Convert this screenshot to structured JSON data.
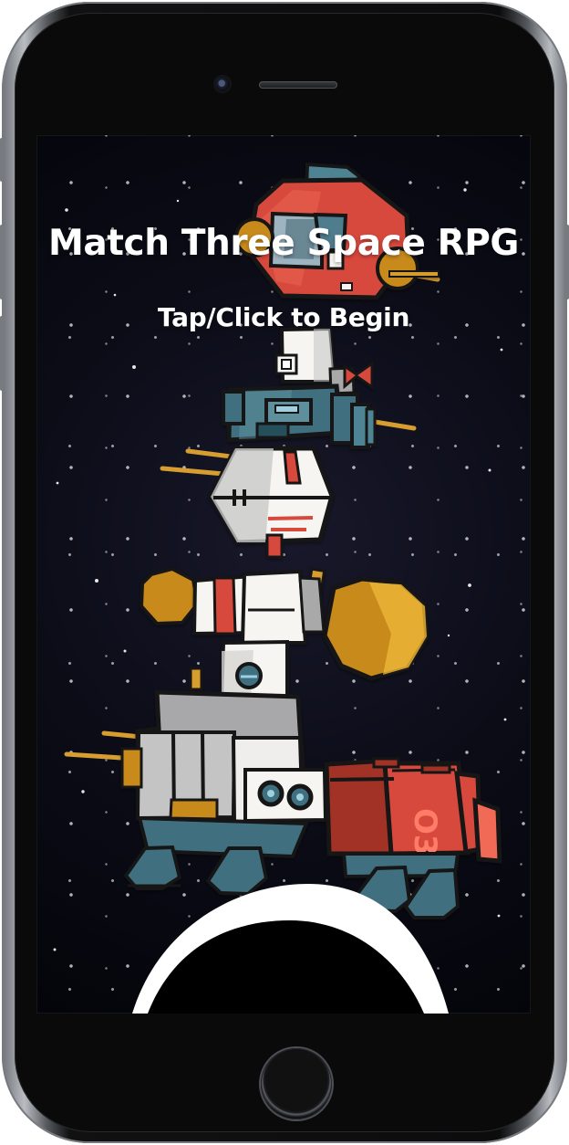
{
  "game": {
    "title": "Match Three Space RPG",
    "prompt": "Tap/Click to Begin"
  },
  "device": {
    "type": "phone-frame",
    "screen_background": "#0b0c17"
  },
  "art": {
    "palette": {
      "red": "#d94c3d",
      "red_dark": "#a23127",
      "teal": "#3e6f7e",
      "teal_dark": "#1f4d5b",
      "gray": "#a8a8aa",
      "white": "#f6f5f2",
      "gold": "#c98a1f",
      "outline": "#131214"
    }
  }
}
